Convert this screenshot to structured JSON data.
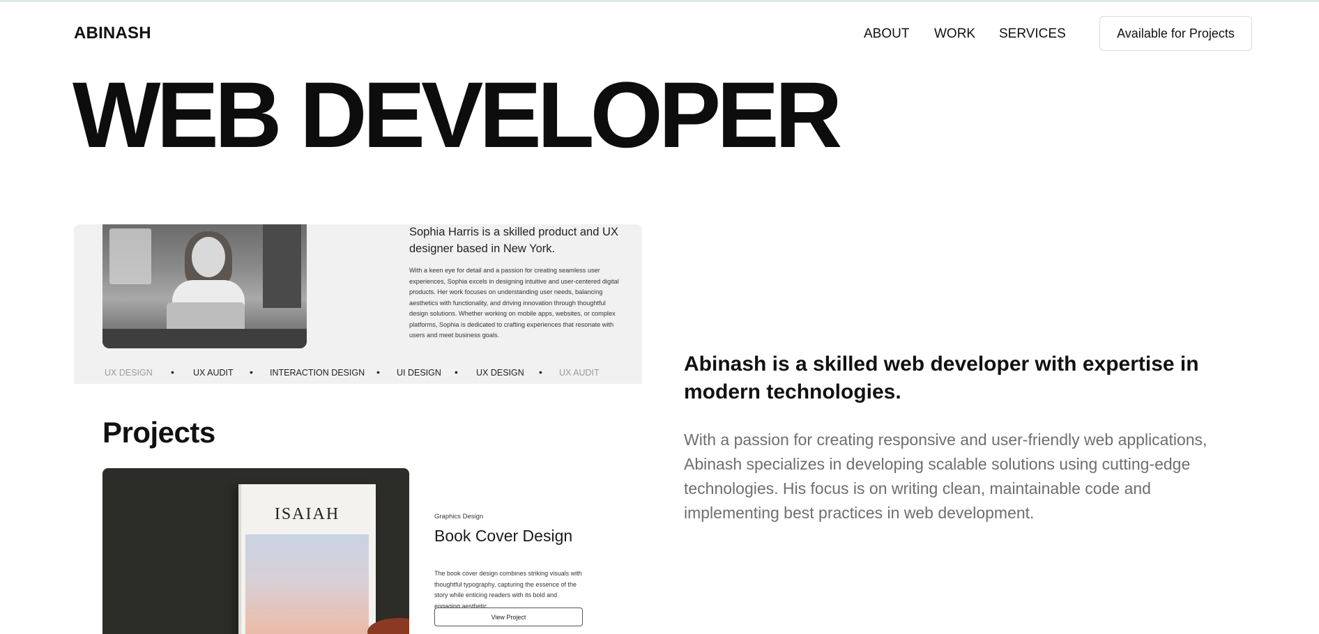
{
  "header": {
    "logo": "ABINASH",
    "nav": [
      "ABOUT",
      "WORK",
      "SERVICES"
    ],
    "cta": "Available for Projects"
  },
  "hero": {
    "title": "WEB DEVELOPER"
  },
  "preview": {
    "bio_heading": "Sophia Harris is a skilled product and UX designer based in New York.",
    "bio_text": "With a keen eye for detail and a passion for creating seamless user experiences, Sophia excels in designing intuitive and user-centered digital products. Her work focuses on understanding user needs, balancing aesthetics with functionality, and driving innovation through thoughtful design solutions. Whether working on mobile apps, websites, or complex platforms, Sophia is dedicated to crafting experiences that resonate with users and meet business goals.",
    "marquee": [
      "UX DESIGN",
      "UX AUDIT",
      "INTERACTION DESIGN",
      "UI DESIGN",
      "UX DESIGN",
      "UX AUDIT"
    ],
    "marquee_sep": "•",
    "projects_title": "Projects",
    "project": {
      "book_title": "ISAIAH",
      "category": "Graphics Design",
      "name": "Book Cover Design",
      "description": "The book cover design combines striking visuals with thoughtful typography, capturing the essence of the story while enticing readers with its bold and engaging aesthetic",
      "button": "View Project"
    }
  },
  "intro": {
    "heading": "Abinash is a skilled web developer with expertise in modern technologies.",
    "text": "With a passion for creating responsive and user-friendly web applications, Abinash specializes in developing scalable solutions using cutting-edge technologies. His focus is on writing clean, maintainable code and implementing best practices in web development."
  },
  "colors": {
    "text_primary": "#111111",
    "text_muted": "#6e6e6e",
    "panel_bg": "#f1f1f1",
    "top_accent": "#dfe9e6"
  },
  "icons": {
    "bullet": "dot-separator-icon"
  }
}
